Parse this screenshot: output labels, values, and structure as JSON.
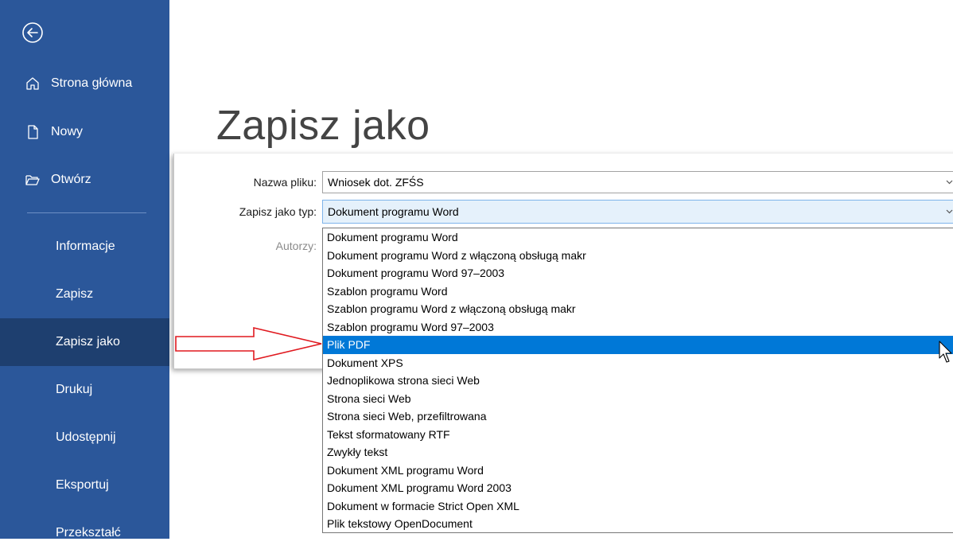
{
  "sidebar": {
    "home": {
      "label": "Strona główna",
      "icon": "home-icon"
    },
    "new": {
      "label": "Nowy",
      "icon": "new-document-icon"
    },
    "open": {
      "label": "Otwórz",
      "icon": "open-folder-icon"
    },
    "items": [
      {
        "label": "Informacje",
        "active": false
      },
      {
        "label": "Zapisz",
        "active": false
      },
      {
        "label": "Zapisz jako",
        "active": true
      },
      {
        "label": "Drukuj",
        "active": false
      },
      {
        "label": "Udostępnij",
        "active": false
      },
      {
        "label": "Eksportuj",
        "active": false
      },
      {
        "label": "Przekształć",
        "active": false
      }
    ]
  },
  "main": {
    "title": "Zapisz jako",
    "filename_label": "Nazwa pliku:",
    "filename_value": "Wniosek dot. ZFŚS",
    "type_label": "Zapisz jako typ:",
    "type_value": "Dokument programu Word",
    "authors_label": "Autorzy:"
  },
  "dropdown": {
    "selected_index": 6,
    "options": [
      "Dokument programu Word",
      "Dokument programu Word z włączoną obsługą makr",
      "Dokument programu Word 97–2003",
      "Szablon programu Word",
      "Szablon programu Word z włączoną obsługą makr",
      "Szablon programu Word 97–2003",
      "Plik PDF",
      "Dokument XPS",
      "Jednoplikowa strona sieci Web",
      "Strona sieci Web",
      "Strona sieci Web, przefiltrowana",
      "Tekst sformatowany RTF",
      "Zwykły tekst",
      "Dokument XML programu Word",
      "Dokument XML programu Word 2003",
      "Dokument w formacie Strict Open XML",
      "Plik tekstowy OpenDocument"
    ]
  },
  "colors": {
    "sidebar_bg": "#2b579a",
    "sidebar_active": "#1e3f6f",
    "selection": "#0078d7",
    "annotation_arrow": "#e0191f"
  }
}
